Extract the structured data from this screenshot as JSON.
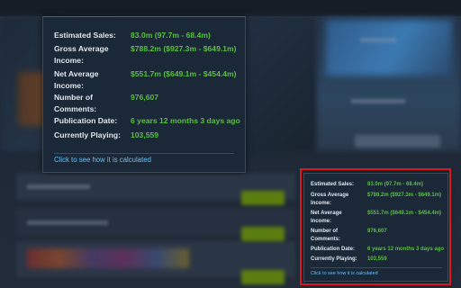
{
  "tooltip": {
    "rows": [
      {
        "label": "Estimated Sales:",
        "value": "83.0m (97.7m - 68.4m)"
      },
      {
        "label": "Gross Average Income:",
        "value": "$788.2m ($927.3m - $649.1m)"
      },
      {
        "label": "Net Average Income:",
        "value": "$551.7m ($649.1m - $454.4m)"
      },
      {
        "label": "Number of Comments:",
        "value": "976,607"
      },
      {
        "label": "Publication Date:",
        "value": "6 years 12 months 3 days ago"
      },
      {
        "label": "Currently Playing:",
        "value": "103,559"
      }
    ],
    "link_label": "Click to see how it is calculated"
  },
  "colors": {
    "panel_bg": "#1b2838",
    "value_green": "#59bf40",
    "link_blue": "#66c0f4",
    "highlight_red": "#d9191f"
  }
}
